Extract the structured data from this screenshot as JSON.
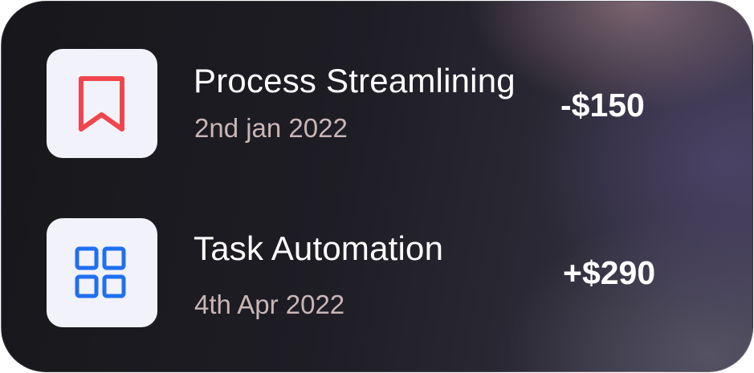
{
  "transactions": [
    {
      "title": "Process Streamlining",
      "date": "2nd jan 2022",
      "amount": "-$150",
      "icon": "bookmark-icon",
      "icon_color": "#f0454c"
    },
    {
      "title": "Task Automation",
      "date": "4th Apr 2022",
      "amount": "+$290",
      "icon": "grid-icon",
      "icon_color": "#1f6ff0"
    }
  ],
  "colors": {
    "icon_bg": "#f2f2fa",
    "title_text": "#ffffff",
    "date_text": "#c9b6b6",
    "card_bg": "#1a1a1f"
  }
}
